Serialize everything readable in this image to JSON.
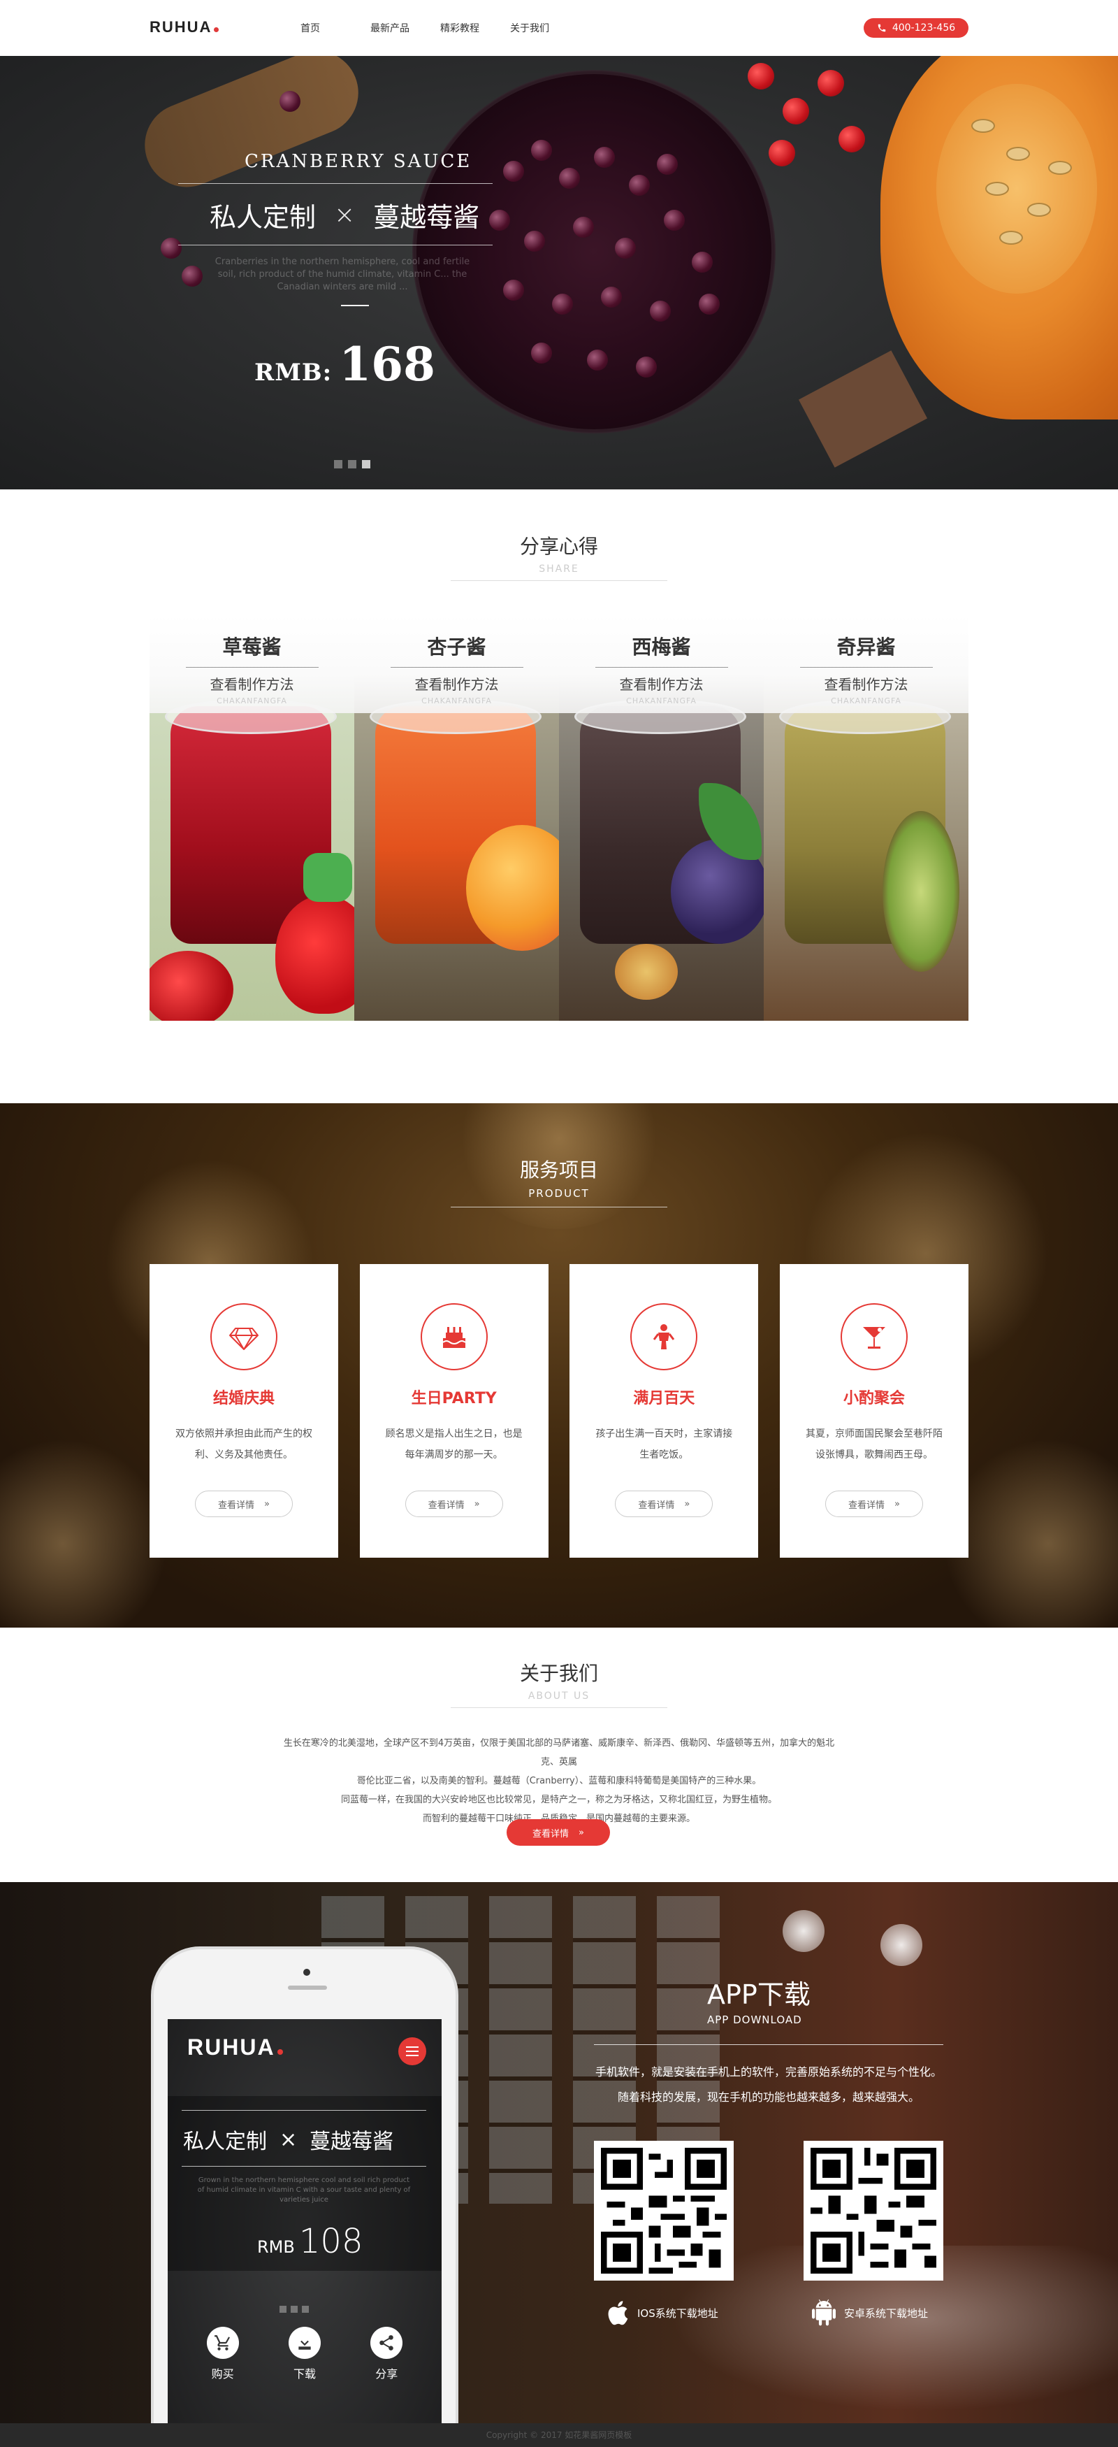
{
  "header": {
    "logo": "RUHUA",
    "nav": [
      "首页",
      "最新产品",
      "精彩教程",
      "关于我们"
    ],
    "phone": "400-123-456"
  },
  "hero": {
    "subtitle": "CRANBERRY SAUCE",
    "title_left": "私人定制",
    "title_sep": "×",
    "title_right": "蔓越莓酱",
    "desc": "Cranberries in the northern hemisphere, cool and fertile soil, rich product of the humid climate, vitamin C... the Canadian winters are mild ... ",
    "price_label": "RMB:",
    "price_value": "168",
    "slides": 3
  },
  "share": {
    "title": "分享心得",
    "subtitle": "SHARE",
    "items": [
      {
        "name": "草莓酱",
        "how": "查看制作方法",
        "pinyin": "CHAKANFANGFA"
      },
      {
        "name": "杏子酱",
        "how": "查看制作方法",
        "pinyin": "CHAKANFANGFA"
      },
      {
        "name": "西梅酱",
        "how": "查看制作方法",
        "pinyin": "CHAKANFANGFA"
      },
      {
        "name": "奇异酱",
        "how": "查看制作方法",
        "pinyin": "CHAKANFANGFA"
      }
    ]
  },
  "services": {
    "title": "服务项目",
    "subtitle": "PRODUCT",
    "items": [
      {
        "icon": "diamond-icon",
        "name": "结婚庆典",
        "desc": "双方依照并承担由此而产生的权利、义务及其他责任。",
        "btn": "查看详情"
      },
      {
        "icon": "cake-icon",
        "name": "生日PARTY",
        "desc": "顾名思义是指人出生之日，也是每年满周岁的那一天。",
        "btn": "查看详情"
      },
      {
        "icon": "baby-icon",
        "name": "满月百天",
        "desc": "孩子出生满一百天时，主家请接生者吃饭。",
        "btn": "查看详情"
      },
      {
        "icon": "cocktail-icon",
        "name": "小酌聚会",
        "desc": "其夏，京师面国民聚会至巷阡陌设张博具，歌舞闹西王母。",
        "btn": "查看详情"
      }
    ]
  },
  "about": {
    "title": "关于我们",
    "subtitle": "ABOUT US",
    "lines": [
      "生长在寒冷的北美湿地，全球产区不到4万英亩，仅限于美国北部的马萨诸塞、威斯康辛、新泽西、俄勒冈、华盛顿等五州，加拿大的魁北克、英属",
      "哥伦比亚二省，以及南美的智利。蔓越莓（Cranberry）、蓝莓和康科特葡萄是美国特产的三种水果。",
      "同蓝莓一样，在我国的大兴安岭地区也比较常见，是特产之一，称之为牙格达，又称北国红豆，为野生植物。",
      "而智利的蔓越莓干口味纯正，品质稳定，是国内蔓越莓的主要来源。"
    ],
    "btn": "查看详情"
  },
  "app": {
    "title": "APP下载",
    "subtitle": "APP DOWNLOAD",
    "desc1": "手机软件，就是安装在手机上的软件，完善原始系统的不足与个性化。",
    "desc2": "随着科技的发展，现在手机的功能也越来越多，越来越强大。",
    "ios": "IOS系统下载地址",
    "android": "安卓系统下载地址",
    "phone": {
      "logo": "RUHUA",
      "title_left": "私人定制",
      "title_sep": "×",
      "title_right": "蔓越莓酱",
      "desc": "Grown in the northern hemisphere cool and soil rich product of humid climate in vitamin C with a sour taste and plenty of varieties juice",
      "price_label": "RMB",
      "price_value": "108",
      "buttons": [
        {
          "icon": "cart-icon",
          "label": "购买"
        },
        {
          "icon": "download-icon",
          "label": "下载"
        },
        {
          "icon": "share-icon",
          "label": "分享"
        }
      ]
    }
  },
  "footer": {
    "copyright": "Copyright © 2017  如花果酱网页模板"
  },
  "colors": {
    "accent": "#e53935",
    "text": "#333333"
  }
}
